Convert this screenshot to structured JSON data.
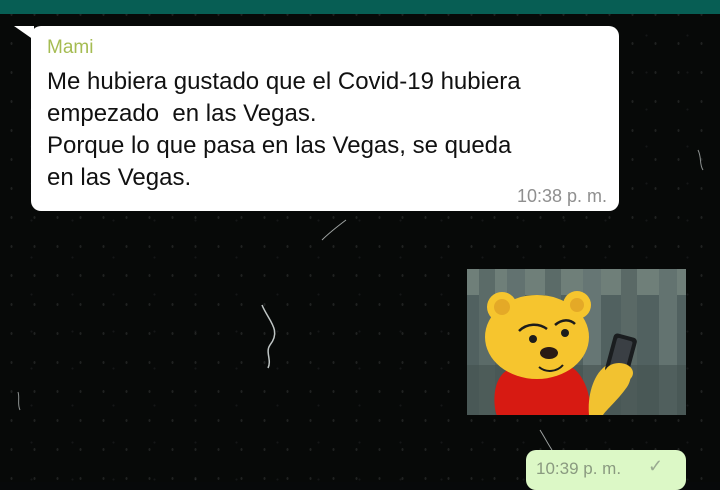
{
  "incoming_message": {
    "sender": "Mami",
    "text": "Me hubiera gustado que el Covid-19 hubiera\nempezado  en las Vegas.\nPorque lo que pasa en las Vegas, se queda\nen las Vegas.",
    "time": "10:38 p. m."
  },
  "outgoing_image": {
    "subject": "winnie-the-pooh-phone"
  },
  "outgoing_message": {
    "time": "10:39 p. m.",
    "status_icon": "check-icon"
  },
  "colors": {
    "header": "#075e54",
    "chat_background": "#070908",
    "incoming_bubble": "#ffffff",
    "outgoing_bubble": "#dcf8c6",
    "sender_name": "#a5bc52"
  }
}
